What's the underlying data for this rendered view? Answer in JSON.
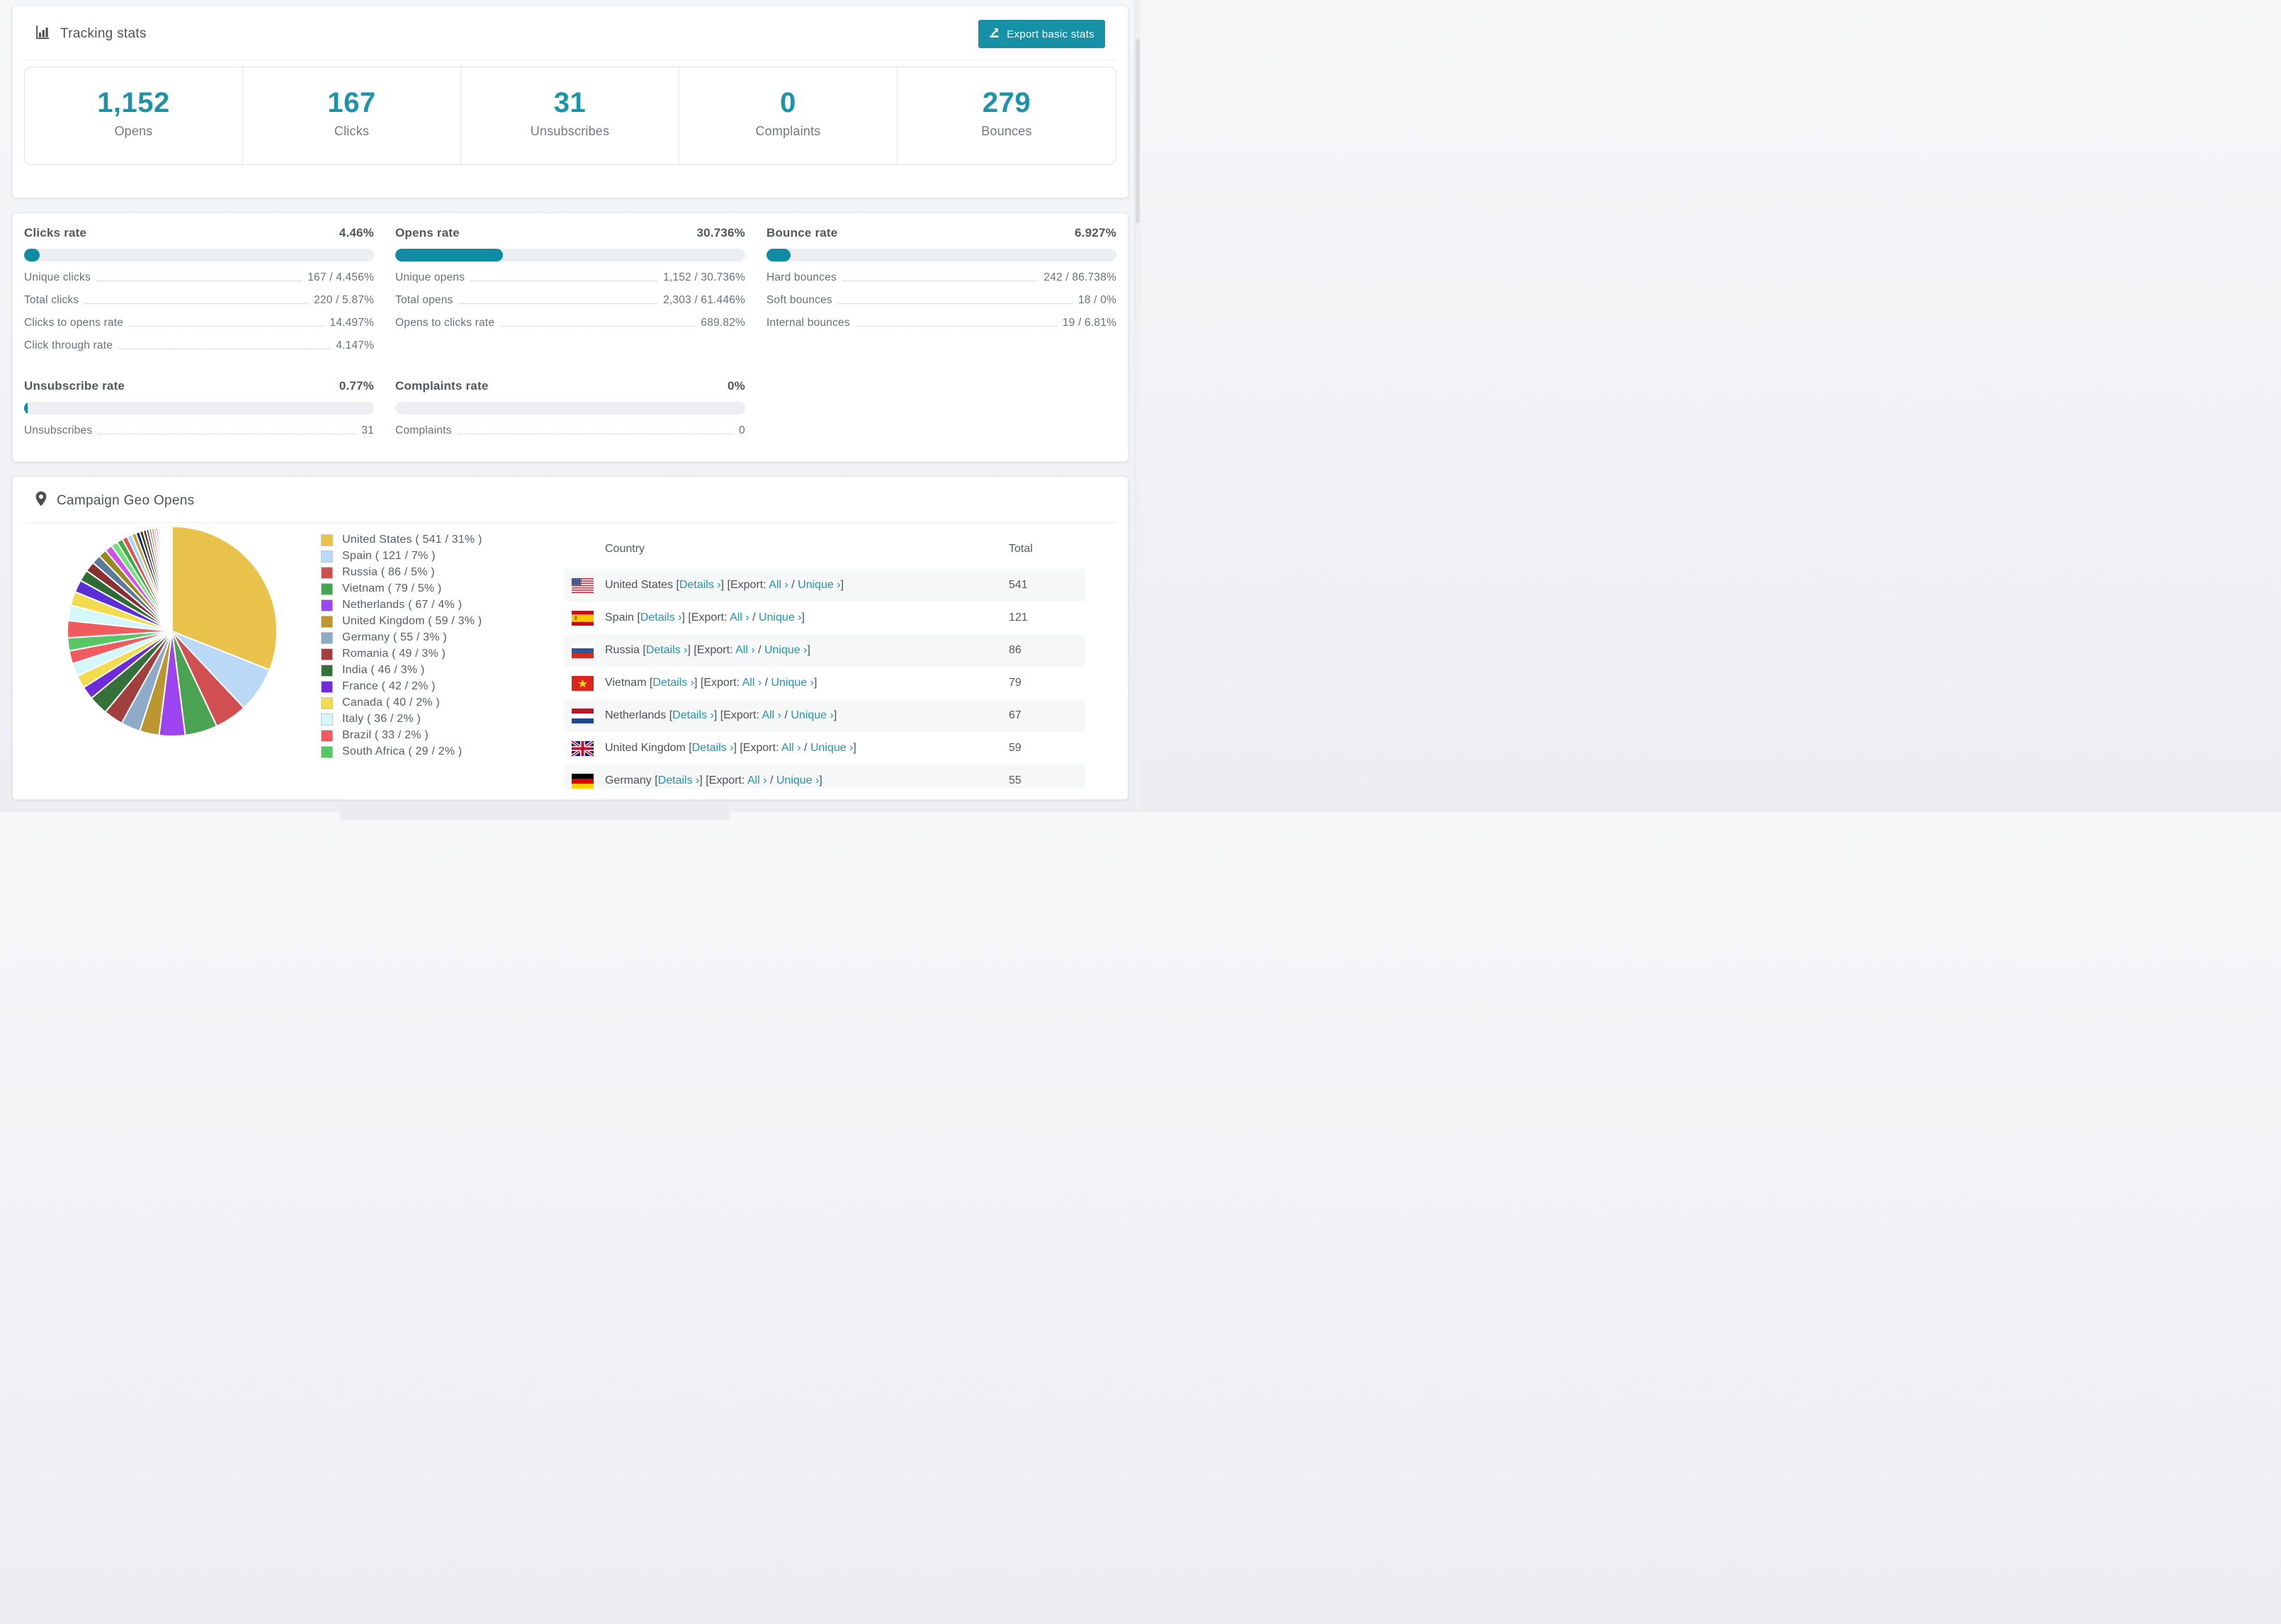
{
  "colors": {
    "accent": "#1791a5",
    "stat_number": "#1b93a8",
    "bar_fill": "#0f8ca4",
    "link": "#2196ad"
  },
  "tracking": {
    "title": "Tracking stats",
    "export_button": "Export basic stats"
  },
  "summary_stats": [
    {
      "value": "1,152",
      "label": "Opens"
    },
    {
      "value": "167",
      "label": "Clicks"
    },
    {
      "value": "31",
      "label": "Unsubscribes"
    },
    {
      "value": "0",
      "label": "Complaints"
    },
    {
      "value": "279",
      "label": "Bounces"
    }
  ],
  "rate_panels": [
    {
      "id": "clicks",
      "title": "Clicks rate",
      "value": "4.46%",
      "percent": 4.46,
      "rows": [
        {
          "label": "Unique clicks",
          "value": "167 / 4.456%"
        },
        {
          "label": "Total clicks",
          "value": "220 / 5.87%"
        },
        {
          "label": "Clicks to opens rate",
          "value": "14.497%"
        },
        {
          "label": "Click through rate",
          "value": "4.147%"
        }
      ]
    },
    {
      "id": "opens",
      "title": "Opens rate",
      "value": "30.736%",
      "percent": 30.736,
      "rows": [
        {
          "label": "Unique opens",
          "value": "1,152 / 30.736%"
        },
        {
          "label": "Total opens",
          "value": "2,303 / 61.446%"
        },
        {
          "label": "Opens to clicks rate",
          "value": "689.82%"
        }
      ]
    },
    {
      "id": "bounce",
      "title": "Bounce rate",
      "value": "6.927%",
      "percent": 6.927,
      "rows": [
        {
          "label": "Hard bounces",
          "value": "242 / 86.738%"
        },
        {
          "label": "Soft bounces",
          "value": "18 / 0%"
        },
        {
          "label": "Internal bounces",
          "value": "19 / 6.81%"
        }
      ]
    },
    {
      "id": "unsubscribe",
      "title": "Unsubscribe rate",
      "value": "0.77%",
      "percent": 0.77,
      "rows": [
        {
          "label": "Unsubscribes",
          "value": "31"
        }
      ]
    },
    {
      "id": "complaints",
      "title": "Complaints rate",
      "value": "0%",
      "percent": 0,
      "rows": [
        {
          "label": "Complaints",
          "value": "0"
        }
      ]
    }
  ],
  "geo": {
    "title": "Campaign Geo Opens",
    "table": {
      "headers": [
        "Country",
        "Total"
      ],
      "link_details": "Details ›",
      "export_prefix": "Export:",
      "link_all": "All ›",
      "link_unique": "Unique ›",
      "rows": [
        {
          "country": "United States",
          "flag": "us",
          "total": "541"
        },
        {
          "country": "Spain",
          "flag": "es",
          "total": "121"
        },
        {
          "country": "Russia",
          "flag": "ru",
          "total": "86"
        },
        {
          "country": "Vietnam",
          "flag": "vn",
          "total": "79"
        },
        {
          "country": "Netherlands",
          "flag": "nl",
          "total": "67"
        },
        {
          "country": "United Kingdom",
          "flag": "gb",
          "total": "59"
        },
        {
          "country": "Germany",
          "flag": "de",
          "total": "55"
        }
      ]
    }
  },
  "chart_data": {
    "type": "pie",
    "title": "Campaign Geo Opens",
    "legend_position": "right",
    "start_angle_deg": -90,
    "direction": "clockwise",
    "slices": [
      {
        "label": "United States",
        "value": 541,
        "pct": 31,
        "color": "#e8c24a"
      },
      {
        "label": "Spain",
        "value": 121,
        "pct": 7,
        "color": "#b9d9f7"
      },
      {
        "label": "Russia",
        "value": 86,
        "pct": 5,
        "color": "#d14f51"
      },
      {
        "label": "Vietnam",
        "value": 79,
        "pct": 5,
        "color": "#4aa353"
      },
      {
        "label": "Netherlands",
        "value": 67,
        "pct": 4,
        "color": "#9b44ef"
      },
      {
        "label": "United Kingdom",
        "value": 59,
        "pct": 3,
        "color": "#bb9631"
      },
      {
        "label": "Germany",
        "value": 55,
        "pct": 3,
        "color": "#8dabc9"
      },
      {
        "label": "Romania",
        "value": 49,
        "pct": 3,
        "color": "#a03f3e"
      },
      {
        "label": "India",
        "value": 46,
        "pct": 3,
        "color": "#35703b"
      },
      {
        "label": "France",
        "value": 42,
        "pct": 2,
        "color": "#6d2bd9"
      },
      {
        "label": "Canada",
        "value": 40,
        "pct": 2,
        "color": "#f2dc4e"
      },
      {
        "label": "Italy",
        "value": 36,
        "pct": 2,
        "color": "#d4f7fb"
      },
      {
        "label": "Brazil",
        "value": 33,
        "pct": 2,
        "color": "#f05b60"
      },
      {
        "label": "South Africa",
        "value": 29,
        "pct": 2,
        "color": "#57c765"
      }
    ],
    "others_pct": 26
  }
}
